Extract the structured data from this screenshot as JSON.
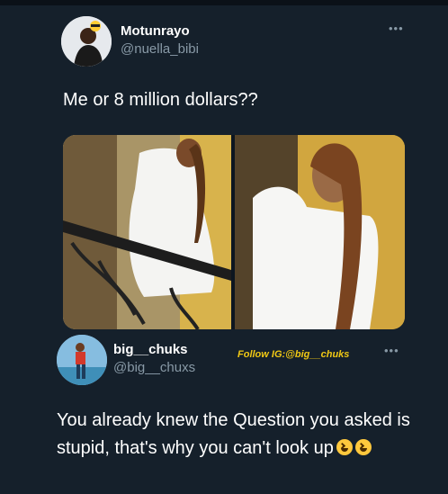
{
  "tweet": {
    "display_name": "Motunrayo",
    "handle": "@nuella_bibi",
    "text": "Me or 8 million dollars??",
    "more_icon": "•••"
  },
  "reply": {
    "display_name": "big__chuks",
    "handle": "@big__chuxs",
    "promo": "Follow IG:@big__chuks",
    "text": "You already knew the Question you asked is stupid, that's why you can't look up",
    "emoji": "grinning-squinting-face",
    "more_icon": "•••"
  },
  "colors": {
    "background": "#15202b",
    "secondary_text": "#8899a6",
    "promo_text": "#f0c814"
  }
}
